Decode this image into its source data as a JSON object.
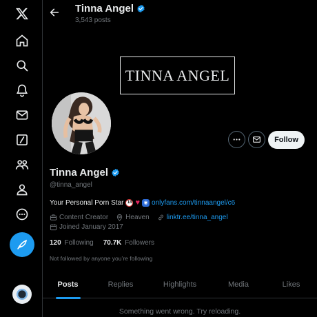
{
  "nav": {
    "items": [
      {
        "name": "x-logo-icon"
      },
      {
        "name": "home-icon"
      },
      {
        "name": "search-icon"
      },
      {
        "name": "notifications-icon"
      },
      {
        "name": "messages-icon"
      },
      {
        "name": "grok-icon"
      },
      {
        "name": "communities-icon"
      },
      {
        "name": "profile-icon"
      },
      {
        "name": "more-icon"
      }
    ],
    "compose_icon": "feather-icon"
  },
  "header": {
    "name": "Tinna Angel",
    "posts": "3,543 posts"
  },
  "banner": {
    "text": "TINNA ANGEL"
  },
  "actions": {
    "follow_label": "Follow"
  },
  "profile": {
    "name": "Tinna Angel",
    "handle": "@tinna_angel",
    "bio_text": "Your Personal Porn Star",
    "bio_emoji_18": "18",
    "bio_link": "onlyfans.com/tinnaangel/c6",
    "category": "Content Creator",
    "location": "Heaven",
    "website": "linktr.ee/tinna_angel",
    "joined": "Joined January 2017",
    "following_count": "120",
    "following_label": "Following",
    "followers_count": "70.7K",
    "followers_label": "Followers",
    "not_followed": "Not followed by anyone you’re following"
  },
  "tabs": [
    {
      "label": "Posts",
      "active": true
    },
    {
      "label": "Replies",
      "active": false
    },
    {
      "label": "Highlights",
      "active": false
    },
    {
      "label": "Media",
      "active": false
    },
    {
      "label": "Likes",
      "active": false
    }
  ],
  "status": {
    "message": "Something went wrong. Try reloading."
  },
  "colors": {
    "accent": "#1d9bf0",
    "background": "#000000",
    "text_primary": "#e7e9ea",
    "text_secondary": "#71767b",
    "border": "#2f3336"
  }
}
